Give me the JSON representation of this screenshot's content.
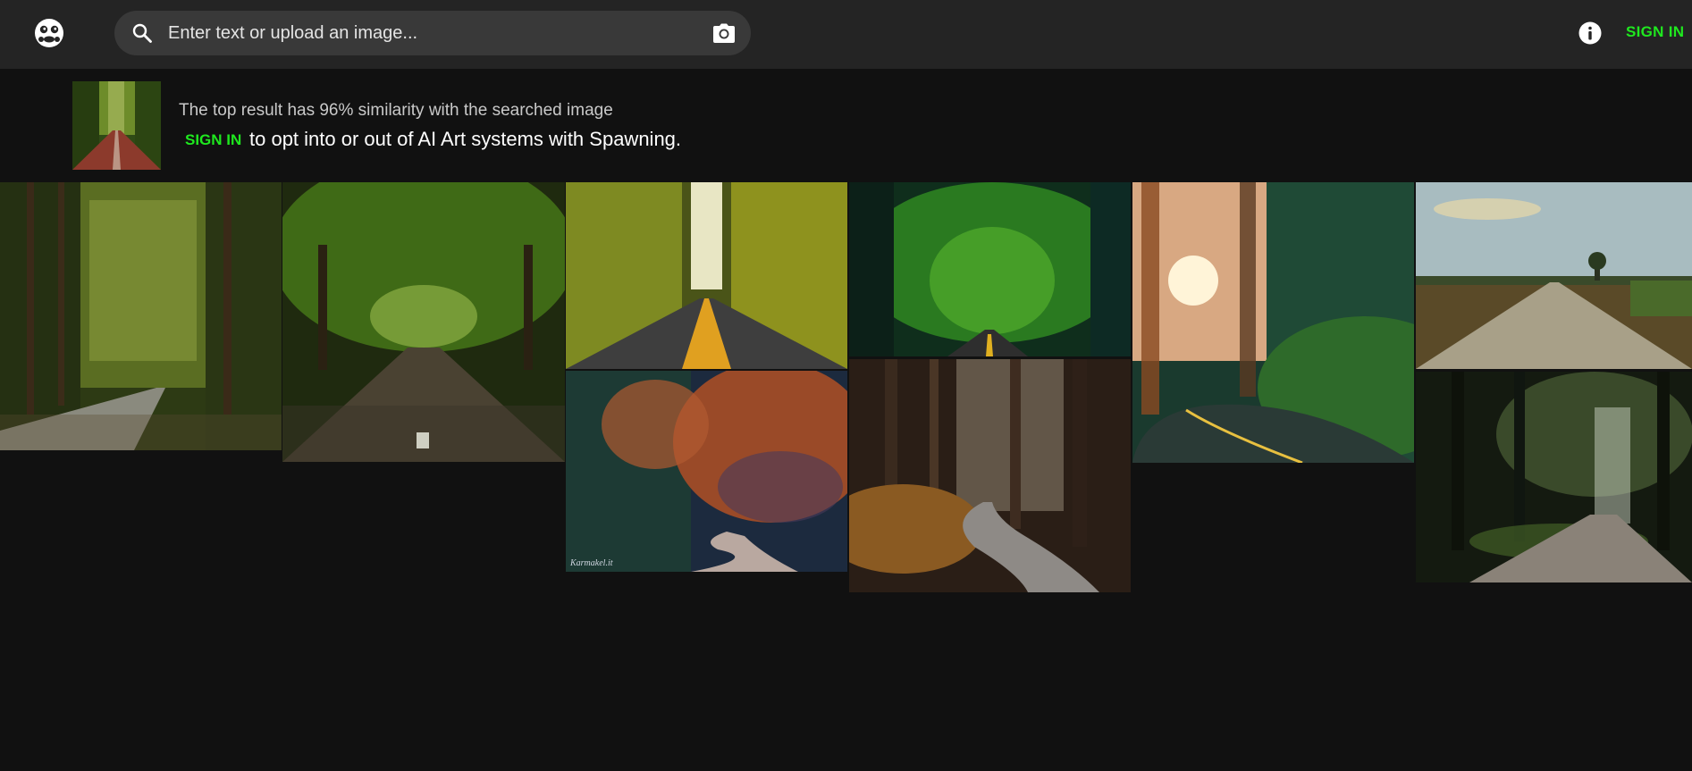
{
  "header": {
    "logo_icon": "mascot-logo-icon",
    "search": {
      "placeholder": "Enter text or upload an image...",
      "value": "",
      "search_icon": "search-icon",
      "camera_icon": "camera-icon"
    },
    "info_icon": "info-icon",
    "sign_in_label": "SIGN IN"
  },
  "banner": {
    "thumbnail": "searched-image-forest-road",
    "title": "The top result has 96% similarity with the searched image",
    "sign_in_label": "SIGN IN",
    "opt_text": "to opt into or out of AI Art systems with Spawning."
  },
  "colors": {
    "background": "#111111",
    "header": "#242424",
    "search_bg": "#393939",
    "accent": "#1fe81f"
  },
  "results": [
    {
      "id": "result-1",
      "scene": "pine forest road curving left"
    },
    {
      "id": "result-2",
      "scene": "green tree tunnel road"
    },
    {
      "id": "result-3",
      "scene": "yellow forest road with center lines"
    },
    {
      "id": "result-4",
      "scene": "deep green forest road"
    },
    {
      "id": "result-5",
      "scene": "sunlit redwood road curve"
    },
    {
      "id": "result-6",
      "scene": "open field road with sky"
    },
    {
      "id": "result-7",
      "scene": "autumn winding forest road",
      "watermark": "Karmakel.it"
    },
    {
      "id": "result-8",
      "scene": "autumn forest dirt path"
    },
    {
      "id": "result-9",
      "scene": "dark forest road with light rays"
    }
  ]
}
